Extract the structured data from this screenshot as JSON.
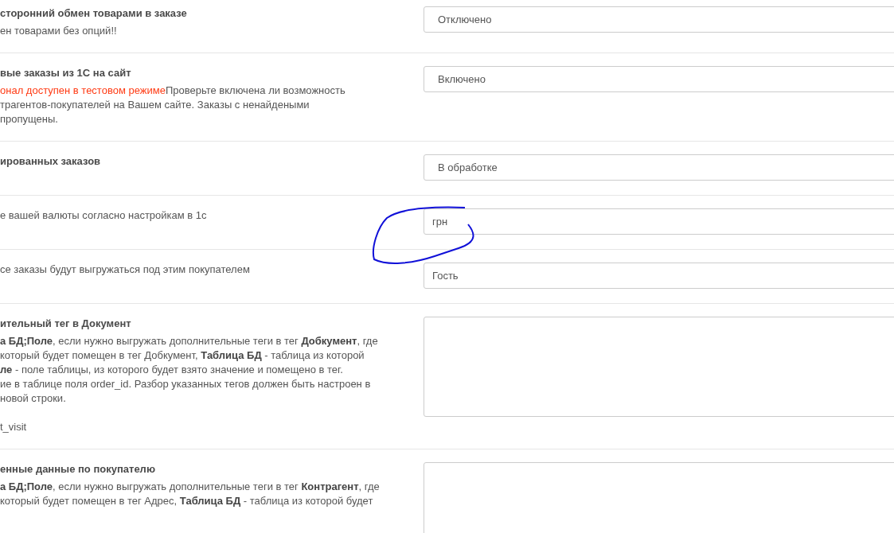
{
  "settings": [
    {
      "title": "сторонний обмен товарами в заказе",
      "lines": [
        {
          "text": "ен товарами без опций!!"
        }
      ],
      "field": {
        "kind": "select",
        "value": "Отключено"
      }
    },
    {
      "title": "вые заказы из 1С на сайт",
      "lines": [
        {
          "warning": "онал доступен в тестовом режиме",
          "text": "Проверьте включена ли возможность"
        },
        {
          "text": "трагентов-покупателей на Вашем сайте. Заказы с ненайдеными"
        },
        {
          "text": "пропущены."
        }
      ],
      "field": {
        "kind": "select",
        "value": "Включено"
      }
    },
    {
      "title": "ированных заказов",
      "field": {
        "kind": "select",
        "value": "В обработке"
      }
    },
    {
      "lines": [
        {
          "text": "е вашей валюты согласно настройкам в 1с"
        }
      ],
      "field": {
        "kind": "input",
        "value": "грн"
      }
    },
    {
      "lines": [
        {
          "text": "се заказы будут выгружаться под этим покупателем"
        }
      ],
      "field": {
        "kind": "input",
        "value": "Гость"
      }
    },
    {
      "title": "ительный тег в Документ",
      "lines": [
        {
          "text": "**а БД;Поле**, если нужно выгружать дополнительные теги в тег **Добкумент**, где"
        },
        {
          "text": "который будет помещен в тег Добкумент, **Таблица БД** - таблица из которой"
        },
        {
          "text": "**ле** - поле таблицы, из которого будет взято значение и помещено в тег."
        },
        {
          "text": "ие в таблице поля order_id. Разбор указанных тегов должен быть настроен в"
        },
        {
          "text": "новой строки."
        },
        {
          "text": "t_visit",
          "kind": "spaced"
        }
      ],
      "field": {
        "kind": "textarea"
      }
    },
    {
      "title": "енные данные по покупателю",
      "lines": [
        {
          "text": "**а БД;Поле**, если нужно выгружать дополнительные теги в тег **Контрагент**, где"
        },
        {
          "text": "который будет помещен в тег Адрес, **Таблица БД** - таблица из которой будет"
        }
      ],
      "field": {
        "kind": "textarea"
      }
    }
  ]
}
